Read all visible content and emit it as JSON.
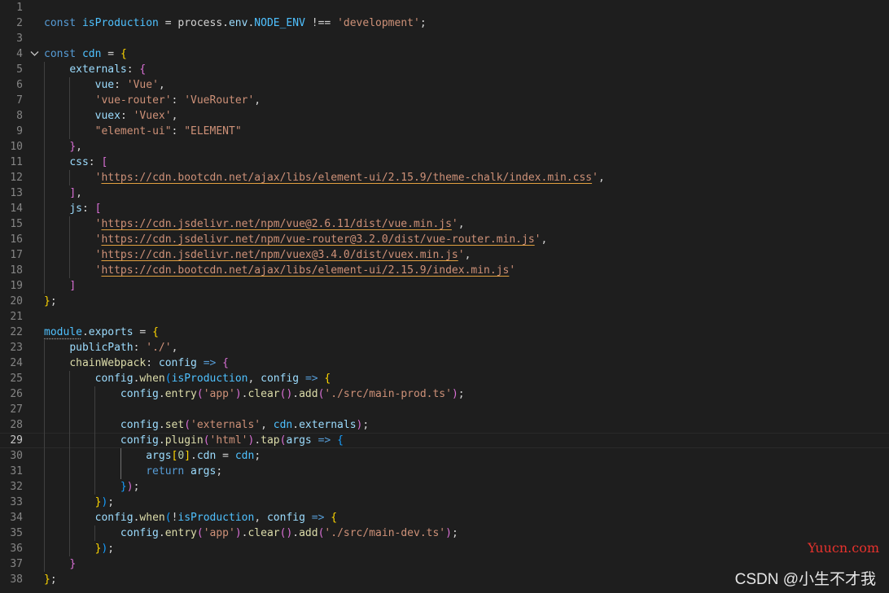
{
  "editor": {
    "theme_colors": {
      "background": "#1e1e1e",
      "line_number": "#858585",
      "keyword": "#569cd6",
      "constant": "#4fc1ff",
      "property": "#9cdcfe",
      "function": "#dcdcaa",
      "string": "#ce9178",
      "number": "#b5cea8",
      "bracket_level_1": "#ffd700",
      "bracket_level_2": "#da70d6",
      "bracket_level_3": "#179fff"
    },
    "current_line": 29,
    "folded_lines": [
      4
    ],
    "lines": [
      {
        "n": "1",
        "tokens": []
      },
      {
        "n": "2",
        "tokens": [
          [
            "kw",
            "const "
          ],
          [
            "var",
            "isProduction"
          ],
          [
            "pun",
            " = process."
          ],
          [
            "prop",
            "env"
          ],
          [
            "pun",
            "."
          ],
          [
            "var",
            "NODE_ENV"
          ],
          [
            "pun",
            " !== "
          ],
          [
            "str",
            "'development'"
          ],
          [
            "pun",
            ";"
          ]
        ]
      },
      {
        "n": "3",
        "tokens": []
      },
      {
        "n": "4",
        "tokens": [
          [
            "kw",
            "const "
          ],
          [
            "var",
            "cdn"
          ],
          [
            "pun",
            " = "
          ],
          [
            "b1",
            "{"
          ]
        ]
      },
      {
        "n": "5",
        "tokens": [
          [
            "pun",
            "    "
          ],
          [
            "prop",
            "externals"
          ],
          [
            "pun",
            ": "
          ],
          [
            "b2",
            "{"
          ]
        ]
      },
      {
        "n": "6",
        "tokens": [
          [
            "pun",
            "        "
          ],
          [
            "prop",
            "vue"
          ],
          [
            "pun",
            ": "
          ],
          [
            "str",
            "'Vue'"
          ],
          [
            "pun",
            ","
          ]
        ]
      },
      {
        "n": "7",
        "tokens": [
          [
            "pun",
            "        "
          ],
          [
            "str",
            "'vue-router'"
          ],
          [
            "pun",
            ": "
          ],
          [
            "str",
            "'VueRouter'"
          ],
          [
            "pun",
            ","
          ]
        ]
      },
      {
        "n": "8",
        "tokens": [
          [
            "pun",
            "        "
          ],
          [
            "prop",
            "vuex"
          ],
          [
            "pun",
            ": "
          ],
          [
            "str",
            "'Vuex'"
          ],
          [
            "pun",
            ","
          ]
        ]
      },
      {
        "n": "9",
        "tokens": [
          [
            "pun",
            "        "
          ],
          [
            "str",
            "\"element-ui\""
          ],
          [
            "pun",
            ": "
          ],
          [
            "str",
            "\"ELEMENT\""
          ]
        ]
      },
      {
        "n": "10",
        "tokens": [
          [
            "pun",
            "    "
          ],
          [
            "b2",
            "}"
          ],
          [
            "pun",
            ","
          ]
        ]
      },
      {
        "n": "11",
        "tokens": [
          [
            "pun",
            "    "
          ],
          [
            "prop",
            "css"
          ],
          [
            "pun",
            ": "
          ],
          [
            "b2",
            "["
          ]
        ]
      },
      {
        "n": "12",
        "tokens": [
          [
            "pun",
            "        "
          ],
          [
            "q",
            "'"
          ],
          [
            "url",
            "https://cdn.bootcdn.net/ajax/libs/element-ui/2.15.9/theme-chalk/index.min.css"
          ],
          [
            "q",
            "'"
          ],
          [
            "pun",
            ","
          ]
        ]
      },
      {
        "n": "13",
        "tokens": [
          [
            "pun",
            "    "
          ],
          [
            "b2",
            "]"
          ],
          [
            "pun",
            ","
          ]
        ]
      },
      {
        "n": "14",
        "tokens": [
          [
            "pun",
            "    "
          ],
          [
            "prop",
            "js"
          ],
          [
            "pun",
            ": "
          ],
          [
            "b2",
            "["
          ]
        ]
      },
      {
        "n": "15",
        "tokens": [
          [
            "pun",
            "        "
          ],
          [
            "q",
            "'"
          ],
          [
            "url",
            "https://cdn.jsdelivr.net/npm/vue@2.6.11/dist/vue.min.js"
          ],
          [
            "q",
            "'"
          ],
          [
            "pun",
            ","
          ]
        ]
      },
      {
        "n": "16",
        "tokens": [
          [
            "pun",
            "        "
          ],
          [
            "q",
            "'"
          ],
          [
            "url",
            "https://cdn.jsdelivr.net/npm/vue-router@3.2.0/dist/vue-router.min.js"
          ],
          [
            "q",
            "'"
          ],
          [
            "pun",
            ","
          ]
        ]
      },
      {
        "n": "17",
        "tokens": [
          [
            "pun",
            "        "
          ],
          [
            "q",
            "'"
          ],
          [
            "url",
            "https://cdn.jsdelivr.net/npm/vuex@3.4.0/dist/vuex.min.js"
          ],
          [
            "q",
            "'"
          ],
          [
            "pun",
            ","
          ]
        ]
      },
      {
        "n": "18",
        "tokens": [
          [
            "pun",
            "        "
          ],
          [
            "q",
            "'"
          ],
          [
            "url",
            "https://cdn.bootcdn.net/ajax/libs/element-ui/2.15.9/index.min.js"
          ],
          [
            "q",
            "'"
          ]
        ]
      },
      {
        "n": "19",
        "tokens": [
          [
            "pun",
            "    "
          ],
          [
            "b2",
            "]"
          ]
        ]
      },
      {
        "n": "20",
        "tokens": [
          [
            "b1",
            "}"
          ],
          [
            "pun",
            ";"
          ]
        ]
      },
      {
        "n": "21",
        "tokens": []
      },
      {
        "n": "22",
        "tokens": [
          [
            "dots",
            "module"
          ],
          [
            "pun",
            "."
          ],
          [
            "prop",
            "exports"
          ],
          [
            "pun",
            " = "
          ],
          [
            "b1",
            "{"
          ]
        ]
      },
      {
        "n": "23",
        "tokens": [
          [
            "pun",
            "    "
          ],
          [
            "prop",
            "publicPath"
          ],
          [
            "pun",
            ": "
          ],
          [
            "str",
            "'./'"
          ],
          [
            "pun",
            ","
          ]
        ]
      },
      {
        "n": "24",
        "tokens": [
          [
            "pun",
            "    "
          ],
          [
            "fn",
            "chainWebpack"
          ],
          [
            "pun",
            ": "
          ],
          [
            "prop",
            "config"
          ],
          [
            "pun",
            " "
          ],
          [
            "kw",
            "=>"
          ],
          [
            "pun",
            " "
          ],
          [
            "b2",
            "{"
          ]
        ]
      },
      {
        "n": "25",
        "tokens": [
          [
            "pun",
            "        "
          ],
          [
            "prop",
            "config"
          ],
          [
            "pun",
            "."
          ],
          [
            "fn",
            "when"
          ],
          [
            "b3",
            "("
          ],
          [
            "var",
            "isProduction"
          ],
          [
            "pun",
            ", "
          ],
          [
            "prop",
            "config"
          ],
          [
            "pun",
            " "
          ],
          [
            "kw",
            "=>"
          ],
          [
            "pun",
            " "
          ],
          [
            "b1",
            "{"
          ]
        ]
      },
      {
        "n": "26",
        "tokens": [
          [
            "pun",
            "            "
          ],
          [
            "prop",
            "config"
          ],
          [
            "pun",
            "."
          ],
          [
            "fn",
            "entry"
          ],
          [
            "b2",
            "("
          ],
          [
            "str",
            "'app'"
          ],
          [
            "b2",
            ")"
          ],
          [
            "pun",
            "."
          ],
          [
            "fn",
            "clear"
          ],
          [
            "b2",
            "()"
          ],
          [
            "pun",
            "."
          ],
          [
            "fn",
            "add"
          ],
          [
            "b2",
            "("
          ],
          [
            "str",
            "'./src/main-prod.ts'"
          ],
          [
            "b2",
            ")"
          ],
          [
            "pun",
            ";"
          ]
        ]
      },
      {
        "n": "27",
        "tokens": []
      },
      {
        "n": "28",
        "tokens": [
          [
            "pun",
            "            "
          ],
          [
            "prop",
            "config"
          ],
          [
            "pun",
            "."
          ],
          [
            "fn",
            "set"
          ],
          [
            "b2",
            "("
          ],
          [
            "str",
            "'externals'"
          ],
          [
            "pun",
            ", "
          ],
          [
            "var",
            "cdn"
          ],
          [
            "pun",
            "."
          ],
          [
            "prop",
            "externals"
          ],
          [
            "b2",
            ")"
          ],
          [
            "pun",
            ";"
          ]
        ]
      },
      {
        "n": "29",
        "tokens": [
          [
            "pun",
            "            "
          ],
          [
            "prop",
            "config"
          ],
          [
            "pun",
            "."
          ],
          [
            "fn",
            "plugin"
          ],
          [
            "b2",
            "("
          ],
          [
            "str",
            "'html'"
          ],
          [
            "b2",
            ")"
          ],
          [
            "pun",
            "."
          ],
          [
            "fn",
            "tap"
          ],
          [
            "b2",
            "("
          ],
          [
            "prop",
            "args"
          ],
          [
            "pun",
            " "
          ],
          [
            "kw",
            "=>"
          ],
          [
            "pun",
            " "
          ],
          [
            "b3",
            "{"
          ]
        ]
      },
      {
        "n": "30",
        "tokens": [
          [
            "pun",
            "                "
          ],
          [
            "prop",
            "args"
          ],
          [
            "b1",
            "["
          ],
          [
            "num",
            "0"
          ],
          [
            "b1",
            "]"
          ],
          [
            "pun",
            "."
          ],
          [
            "prop",
            "cdn"
          ],
          [
            "pun",
            " = "
          ],
          [
            "var",
            "cdn"
          ],
          [
            "pun",
            ";"
          ]
        ]
      },
      {
        "n": "31",
        "tokens": [
          [
            "pun",
            "                "
          ],
          [
            "kw",
            "return "
          ],
          [
            "prop",
            "args"
          ],
          [
            "pun",
            ";"
          ]
        ]
      },
      {
        "n": "32",
        "tokens": [
          [
            "pun",
            "            "
          ],
          [
            "b3",
            "}"
          ],
          [
            "b2",
            ")"
          ],
          [
            "pun",
            ";"
          ]
        ]
      },
      {
        "n": "33",
        "tokens": [
          [
            "pun",
            "        "
          ],
          [
            "b1",
            "}"
          ],
          [
            "b3",
            ")"
          ],
          [
            "pun",
            ";"
          ]
        ]
      },
      {
        "n": "34",
        "tokens": [
          [
            "pun",
            "        "
          ],
          [
            "prop",
            "config"
          ],
          [
            "pun",
            "."
          ],
          [
            "fn",
            "when"
          ],
          [
            "b3",
            "("
          ],
          [
            "pun",
            "!"
          ],
          [
            "var",
            "isProduction"
          ],
          [
            "pun",
            ", "
          ],
          [
            "prop",
            "config"
          ],
          [
            "pun",
            " "
          ],
          [
            "kw",
            "=>"
          ],
          [
            "pun",
            " "
          ],
          [
            "b1",
            "{"
          ]
        ]
      },
      {
        "n": "35",
        "tokens": [
          [
            "pun",
            "            "
          ],
          [
            "prop",
            "config"
          ],
          [
            "pun",
            "."
          ],
          [
            "fn",
            "entry"
          ],
          [
            "b2",
            "("
          ],
          [
            "str",
            "'app'"
          ],
          [
            "b2",
            ")"
          ],
          [
            "pun",
            "."
          ],
          [
            "fn",
            "clear"
          ],
          [
            "b2",
            "()"
          ],
          [
            "pun",
            "."
          ],
          [
            "fn",
            "add"
          ],
          [
            "b2",
            "("
          ],
          [
            "str",
            "'./src/main-dev.ts'"
          ],
          [
            "b2",
            ")"
          ],
          [
            "pun",
            ";"
          ]
        ]
      },
      {
        "n": "36",
        "tokens": [
          [
            "pun",
            "        "
          ],
          [
            "b1",
            "}"
          ],
          [
            "b3",
            ")"
          ],
          [
            "pun",
            ";"
          ]
        ]
      },
      {
        "n": "37",
        "tokens": [
          [
            "pun",
            "    "
          ],
          [
            "b2",
            "}"
          ]
        ]
      },
      {
        "n": "38",
        "tokens": [
          [
            "b1",
            "}"
          ],
          [
            "pun",
            ";"
          ]
        ]
      }
    ]
  },
  "watermarks": {
    "site": "Yuucn.com",
    "author": "CSDN @小生不才我"
  }
}
